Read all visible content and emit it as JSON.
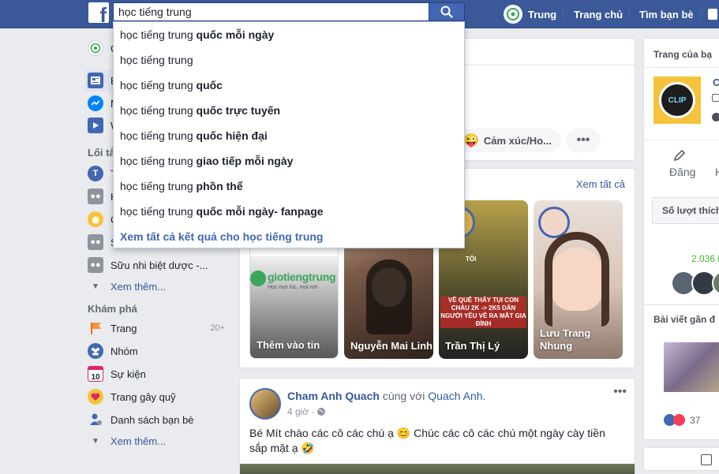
{
  "search": {
    "value": "học tiếng trung"
  },
  "nav": {
    "profile_name": "Trung",
    "home": "Trang chủ",
    "find_friends": "Tìm bạn bè"
  },
  "suggestions": [
    {
      "prefix": "học tiếng trung",
      "bold": " quốc mỗi ngày"
    },
    {
      "prefix": "học tiếng trung",
      "bold": ""
    },
    {
      "prefix": "học tiếng trung",
      "bold": " quốc"
    },
    {
      "prefix": "học tiếng trung",
      "bold": " quốc trực tuyến"
    },
    {
      "prefix": "học tiếng trung",
      "bold": " quốc hiện đại"
    },
    {
      "prefix": "học tiếng trung",
      "bold": " giao tiếp mỗi ngày"
    },
    {
      "prefix": "học tiếng trung",
      "bold": " phồn thể"
    },
    {
      "prefix": "học tiếng trung",
      "bold": " quốc mỗi ngày- fanpage"
    }
  ],
  "see_all_results": "Xem tất cả kết quả cho học tiếng trung",
  "left": {
    "top_items": [
      {
        "label": "C",
        "icon": "profile-avatar-icon"
      },
      {
        "label": "B",
        "icon": "news-feed-icon"
      },
      {
        "label": "M",
        "icon": "messenger-icon"
      },
      {
        "label": "W",
        "icon": "watch-icon"
      }
    ],
    "shortcuts_heading": "Lối tắ",
    "shortcuts": [
      {
        "label": "T",
        "icon": "group-t-icon"
      },
      {
        "label": "H",
        "icon": "group-icon"
      },
      {
        "label": "C",
        "icon": "page-icon"
      },
      {
        "label": "S",
        "icon": "group-icon"
      },
      {
        "label": "Sữu nhi biệt dược -...",
        "icon": "group-icon"
      }
    ],
    "see_more_1": "Xem thêm...",
    "explore_heading": "Khám phá",
    "explore": [
      {
        "label": "Trang",
        "count": "20+",
        "icon": "flag-icon"
      },
      {
        "label": "Nhóm",
        "count": "",
        "icon": "groups-icon"
      },
      {
        "label": "Sự kiện",
        "count": "",
        "icon": "calendar-icon",
        "day": "10"
      },
      {
        "label": "Trang gây quỹ",
        "count": "",
        "icon": "fundraiser-icon"
      },
      {
        "label": "Danh sách bạn bè",
        "count": "",
        "icon": "friend-list-icon"
      }
    ],
    "see_more_2": "Xem thêm..."
  },
  "composer": {
    "feeling_label": "Cảm xúc/Ho..."
  },
  "stories": {
    "see_all": "Xem tất cả",
    "items": [
      {
        "name": "Thêm vào tin",
        "logo_text": "giotiengtrung",
        "logo_sub": "Học mọi lúc, mọi nơi"
      },
      {
        "name": "Nguyễn Mai Linh"
      },
      {
        "name": "Trần Thị Lý",
        "overlay_top": "TÔI",
        "overlay_text": "VỀ QUÊ THẤY TỤI CON CHÁU 2K -> 2K5 DẪN NGƯỜI YÊU VỀ RA MẮT GIA ĐÌNH"
      },
      {
        "name": "Lưu Trang Nhung"
      }
    ]
  },
  "post": {
    "author": "Cham Anh Quach",
    "with_text": "cùng với",
    "with_name": "Quach Anh.",
    "time": "4 giờ",
    "text": "Bé Mít chào các cô các chú ạ 😊 Chúc các cô các chú một ngày cày tiền sắp mặt ạ 🤣"
  },
  "right": {
    "pages_heading": "Trang của bạ",
    "page_letter": "C",
    "page_logo_text": "CLIP",
    "post_action": "Đăng",
    "post_action_2": "H",
    "likes_label": "Số lượt thích",
    "likes_count": "2.036 l",
    "recent_heading": "Bài viết gần đ",
    "reaction_count": "37"
  },
  "colors": {
    "brand": "#3b5998",
    "link": "#365899",
    "accent": "#4267b2"
  }
}
